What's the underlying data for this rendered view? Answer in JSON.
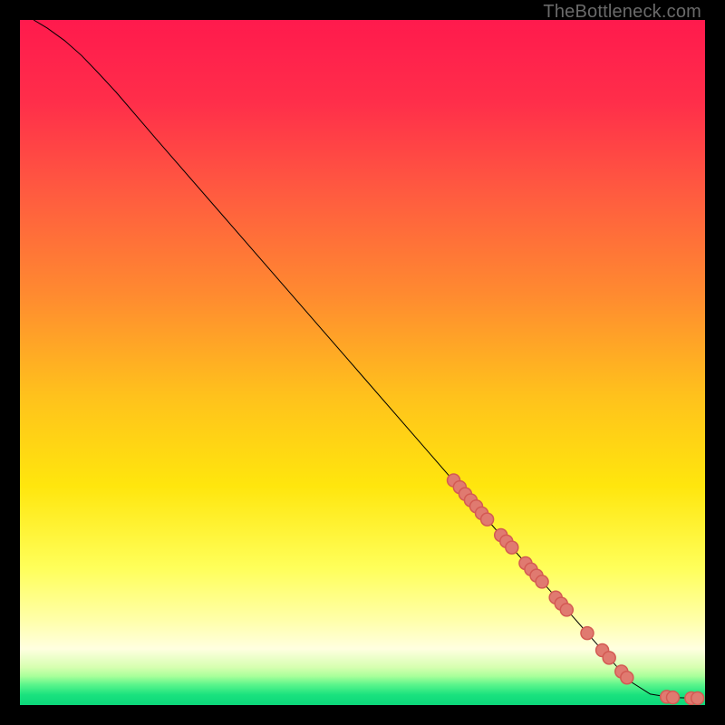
{
  "attribution": "TheBottleneck.com",
  "chart_data": {
    "type": "line",
    "title": "",
    "xlabel": "",
    "ylabel": "",
    "xlim": [
      0,
      100
    ],
    "ylim": [
      0,
      100
    ],
    "background_gradient": {
      "stops": [
        {
          "t": 0.0,
          "color": "#ff1a4d"
        },
        {
          "t": 0.12,
          "color": "#ff2e4a"
        },
        {
          "t": 0.25,
          "color": "#ff5a40"
        },
        {
          "t": 0.4,
          "color": "#ff8a30"
        },
        {
          "t": 0.55,
          "color": "#ffc21c"
        },
        {
          "t": 0.68,
          "color": "#ffe60d"
        },
        {
          "t": 0.8,
          "color": "#ffff5a"
        },
        {
          "t": 0.875,
          "color": "#ffffa8"
        },
        {
          "t": 0.918,
          "color": "#ffffe0"
        },
        {
          "t": 0.945,
          "color": "#d6ffb0"
        },
        {
          "t": 0.958,
          "color": "#a8ff9a"
        },
        {
          "t": 0.97,
          "color": "#5cf58c"
        },
        {
          "t": 0.985,
          "color": "#1ae27e"
        },
        {
          "t": 1.0,
          "color": "#0bd77a"
        }
      ]
    },
    "series": [
      {
        "name": "curve",
        "type": "line",
        "color": "#000000",
        "width": 1,
        "points": [
          {
            "x": 2.0,
            "y": 100.0
          },
          {
            "x": 4.0,
            "y": 98.8
          },
          {
            "x": 6.5,
            "y": 97.0
          },
          {
            "x": 9.0,
            "y": 94.8
          },
          {
            "x": 11.5,
            "y": 92.2
          },
          {
            "x": 14.0,
            "y": 89.5
          },
          {
            "x": 20.0,
            "y": 82.5
          },
          {
            "x": 30.0,
            "y": 71.0
          },
          {
            "x": 40.0,
            "y": 59.5
          },
          {
            "x": 50.0,
            "y": 48.0
          },
          {
            "x": 60.0,
            "y": 36.5
          },
          {
            "x": 70.0,
            "y": 25.0
          },
          {
            "x": 78.0,
            "y": 16.0
          },
          {
            "x": 85.0,
            "y": 8.0
          },
          {
            "x": 89.0,
            "y": 3.5
          },
          {
            "x": 92.0,
            "y": 1.6
          },
          {
            "x": 95.0,
            "y": 1.1
          },
          {
            "x": 99.0,
            "y": 1.0
          }
        ]
      },
      {
        "name": "markers",
        "type": "scatter",
        "marker": {
          "shape": "circle",
          "radius": 7,
          "fill": "#e07a70",
          "stroke": "#d35a53",
          "stroke_width": 1.5
        },
        "points": [
          {
            "x": 63.3,
            "y": 32.8
          },
          {
            "x": 64.2,
            "y": 31.8
          },
          {
            "x": 65.0,
            "y": 30.8
          },
          {
            "x": 65.8,
            "y": 29.9
          },
          {
            "x": 66.6,
            "y": 29.0
          },
          {
            "x": 67.4,
            "y": 28.0
          },
          {
            "x": 68.2,
            "y": 27.1
          },
          {
            "x": 70.2,
            "y": 24.8
          },
          {
            "x": 71.0,
            "y": 23.9
          },
          {
            "x": 71.8,
            "y": 23.0
          },
          {
            "x": 73.8,
            "y": 20.7
          },
          {
            "x": 74.6,
            "y": 19.8
          },
          {
            "x": 75.4,
            "y": 18.9
          },
          {
            "x": 76.2,
            "y": 18.0
          },
          {
            "x": 78.2,
            "y": 15.7
          },
          {
            "x": 79.0,
            "y": 14.8
          },
          {
            "x": 79.8,
            "y": 13.9
          },
          {
            "x": 82.8,
            "y": 10.5
          },
          {
            "x": 85.0,
            "y": 8.0
          },
          {
            "x": 86.0,
            "y": 6.9
          },
          {
            "x": 87.8,
            "y": 4.9
          },
          {
            "x": 88.6,
            "y": 4.0
          },
          {
            "x": 94.4,
            "y": 1.2
          },
          {
            "x": 95.3,
            "y": 1.1
          },
          {
            "x": 98.0,
            "y": 1.0
          },
          {
            "x": 98.9,
            "y": 1.0
          }
        ]
      }
    ]
  }
}
